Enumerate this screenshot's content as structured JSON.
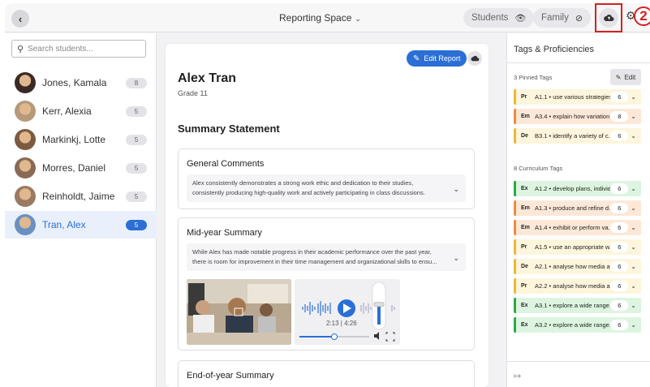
{
  "topbar": {
    "back_icon": "chevron-left-icon",
    "space_title": "Reporting Space",
    "students_label": "Students",
    "family_label": "Family",
    "callout": "2"
  },
  "sidebar": {
    "search_placeholder": "Search students...",
    "students": [
      {
        "name": "Jones, Kamala",
        "count": "8",
        "avatar_color": "#3a2a25"
      },
      {
        "name": "Kerr, Alexia",
        "count": "5",
        "avatar_color": "#b59a7a"
      },
      {
        "name": "Markinkj, Lotte",
        "count": "5",
        "avatar_color": "#7a5a40"
      },
      {
        "name": "Morres, Daniel",
        "count": "5",
        "avatar_color": "#8a6a55"
      },
      {
        "name": "Reinholdt, Jaime",
        "count": "5",
        "avatar_color": "#9a7a60"
      },
      {
        "name": "Tran, Alex",
        "count": "5",
        "avatar_color": "#6a90c0"
      }
    ]
  },
  "main": {
    "edit_report_label": "Edit Report",
    "student_name": "Alex Tran",
    "grade": "Grade 11",
    "summary_heading": "Summary Statement",
    "general": {
      "title": "General Comments",
      "text": "Alex consistently demonstrates a strong work ethic and dedication to their studies, consistently producing high-quality work and actively participating in class discussions."
    },
    "midyear": {
      "title": "Mid-year Summary",
      "text": "While Alex has made notable progress in their academic performance over the past year, there is room for improvement in their time management and organizational skills to ensu...",
      "audio_time": "2:13 | 4:26",
      "audio_progress": 0.5,
      "volume_level": 0.55
    },
    "endyear": {
      "title": "End-of-year Summary"
    }
  },
  "right": {
    "title": "Tags & Proficiencies",
    "edit_label": "Edit",
    "pinned_label": "3 Pinned Tags",
    "curriculum_label": "8 Curriculum Tags",
    "pinned": [
      {
        "code": "Pr",
        "text": "A1.1 • use various strategies...",
        "level": "6",
        "bg": "#fdf5dc",
        "bar": "#e8b93a"
      },
      {
        "code": "Em",
        "text": "A3.4 • explain how variation...",
        "level": "8",
        "bg": "#fde8d8",
        "bar": "#f08a40"
      },
      {
        "code": "De",
        "text": "B3.1 • identify a variety of c...",
        "level": "6",
        "bg": "#fdf5dc",
        "bar": "#e8b93a"
      }
    ],
    "curriculum": [
      {
        "code": "Ex",
        "text": "A1.2 • develop plans, individ...",
        "level": "6",
        "bg": "#ddf5e0",
        "bar": "#2ea84a"
      },
      {
        "code": "Em",
        "text": "A1.3 • produce and refine d...",
        "level": "6",
        "bg": "#fde8d8",
        "bar": "#f08a40"
      },
      {
        "code": "Em",
        "text": "A1.4 • exhibit or perform va...",
        "level": "6",
        "bg": "#fde8d8",
        "bar": "#f08a40"
      },
      {
        "code": "Pr",
        "text": "A1.5 • use an appropriate w...",
        "level": "6",
        "bg": "#fdf5dc",
        "bar": "#e8b93a"
      },
      {
        "code": "De",
        "text": "A2.1 • analyse how media af...",
        "level": "6",
        "bg": "#fdf5dc",
        "bar": "#e8b93a"
      },
      {
        "code": "Pr",
        "text": "A2.2 • analyse how media a...",
        "level": "6",
        "bg": "#fdf5dc",
        "bar": "#e8b93a"
      },
      {
        "code": "Ex",
        "text": "A3.1 • explore a wide range...",
        "level": "6",
        "bg": "#ddf5e0",
        "bar": "#2ea84a"
      },
      {
        "code": "Ex",
        "text": "A3.2 • explore a wide range...",
        "level": "6",
        "bg": "#ddf5e0",
        "bar": "#2ea84a"
      }
    ]
  }
}
